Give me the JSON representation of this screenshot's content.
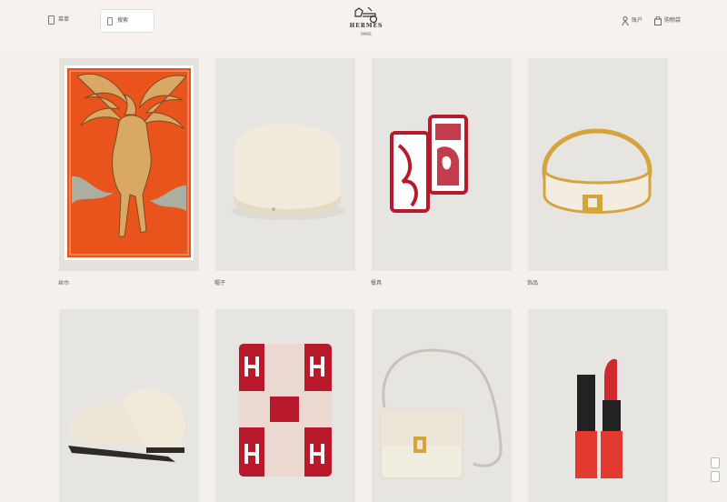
{
  "header": {
    "menu_label": "菜单",
    "search_label": "搜索",
    "brand": "HERMÈS",
    "brand_sub": "PARIS",
    "account_label": "账户",
    "cart_label": "购物袋"
  },
  "products": [
    {
      "label": "丝巾"
    },
    {
      "label": "帽子"
    },
    {
      "label": "餐具"
    },
    {
      "label": "饰品"
    },
    {
      "label": ""
    },
    {
      "label": ""
    },
    {
      "label": ""
    },
    {
      "label": ""
    }
  ],
  "colors": {
    "background": "#f4f1ec",
    "hermes_orange": "#e8541c",
    "hermes_red": "#b91a2b",
    "gold": "#d5a43a"
  }
}
